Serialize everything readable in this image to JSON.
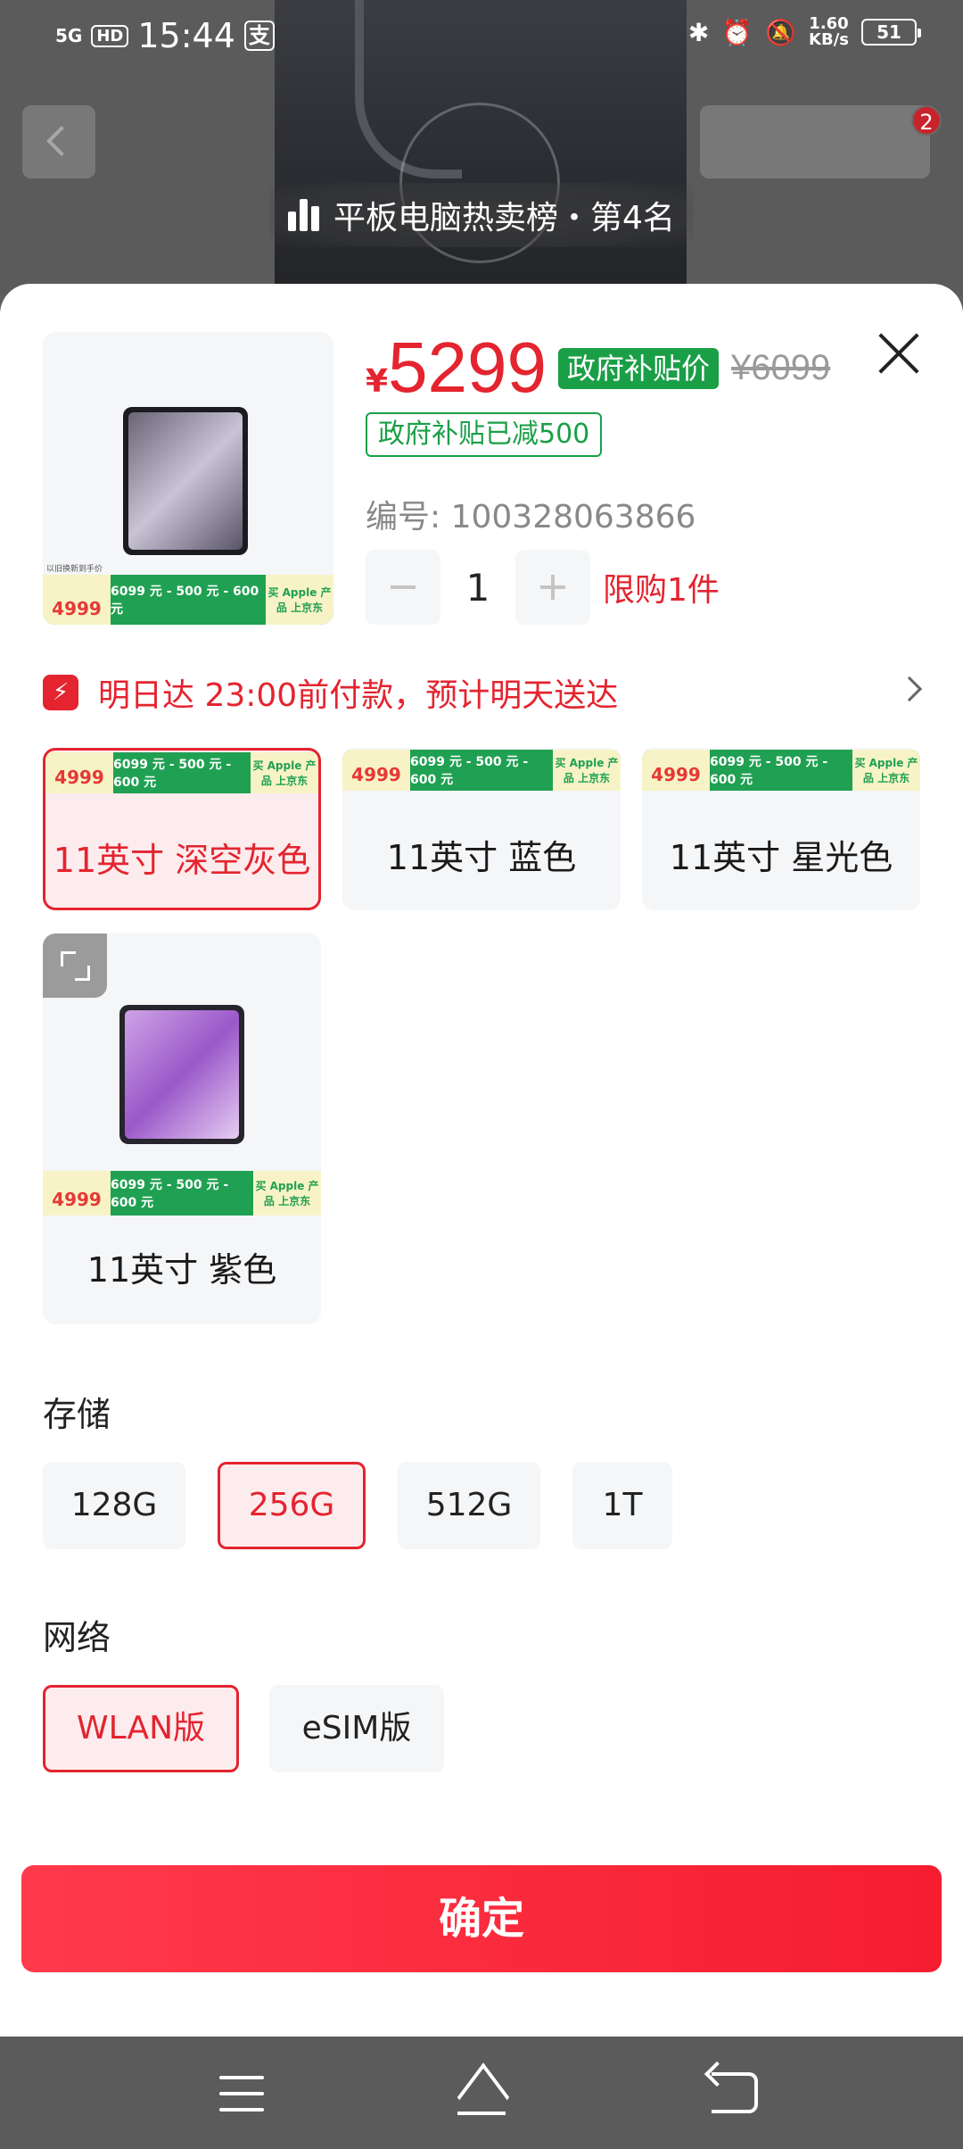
{
  "status_bar": {
    "signal": "5G",
    "hd": "HD",
    "time": "15:44",
    "pay_icon": "支",
    "net_speed_value": "1.60",
    "net_speed_unit": "KB/s",
    "battery": "51",
    "icons": [
      "bluetooth-icon",
      "alarm-icon",
      "mute-icon"
    ]
  },
  "background": {
    "cart_badge": "2",
    "rank_text": "平板电脑热卖榜・第4名"
  },
  "product": {
    "currency": "¥",
    "price": "5299",
    "gov_tag": "政府补贴价",
    "original_price": "¥6099",
    "subsidy_tag": "政府补贴已减500",
    "sku": "编号: 100328063866",
    "quantity": "1",
    "limit": "限购1件"
  },
  "promo_banner": {
    "price": "4999",
    "unit": "元",
    "formula": "6099 元 - 500 元 - 600 元",
    "right_text": "买 Apple 产品 上京东"
  },
  "delivery": {
    "icon": "bolt-icon",
    "text": "明日达 23:00前付款，预计明天送达"
  },
  "colors": [
    {
      "label": "11英寸 深空灰色",
      "selected": true
    },
    {
      "label": "11英寸 蓝色",
      "selected": false
    },
    {
      "label": "11英寸 星光色",
      "selected": false
    },
    {
      "label": "11英寸 紫色",
      "selected": false
    }
  ],
  "storage": {
    "title": "存储",
    "options": [
      "128G",
      "256G",
      "512G",
      "1T"
    ],
    "selected": "256G"
  },
  "network": {
    "title": "网络",
    "options": [
      "WLAN版",
      "eSIM版"
    ],
    "selected": "WLAN版"
  },
  "confirm_label": "确定",
  "theme": {
    "accent": "#e4242f",
    "green": "#1a9f47"
  }
}
